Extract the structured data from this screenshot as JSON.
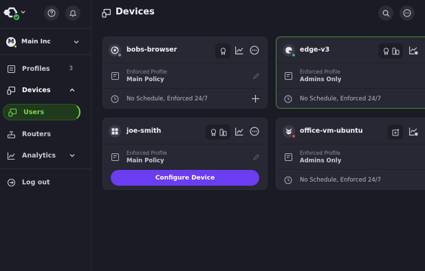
{
  "sidebar": {
    "org": {
      "initial": "M",
      "name": "Main Inc"
    },
    "items": [
      {
        "label": "Profiles",
        "count": "3"
      },
      {
        "label": "Devices"
      },
      {
        "label": "Users"
      },
      {
        "label": "Routers"
      },
      {
        "label": "Analytics"
      },
      {
        "label": "Log out"
      }
    ]
  },
  "header": {
    "title": "Devices"
  },
  "devices": [
    {
      "name": "bobs-browser",
      "profile_label": "Enforced Profile",
      "profile": "Main Policy",
      "schedule": "No Schedule, Enforced 24/7"
    },
    {
      "name": "edge-v3",
      "profile_label": "Enforced Profile",
      "profile": "Admins Only",
      "schedule": "No Schedule, Enforced 24/7"
    },
    {
      "name": "joe-smith",
      "profile_label": "Enforced Profile",
      "profile": "Main Policy",
      "button": "Configure Device"
    },
    {
      "name": "office-vm-ubuntu",
      "profile_label": "Enforced Profile",
      "profile": "Admins Only",
      "schedule": "No Schedule, Enforced 24/7"
    }
  ],
  "colors": {
    "accent_green": "#77d44e",
    "accent_purple": "#6b3df0",
    "status_online": "#3fb950",
    "status_offline": "#e5484d",
    "status_idle": "#8d8f9c"
  }
}
